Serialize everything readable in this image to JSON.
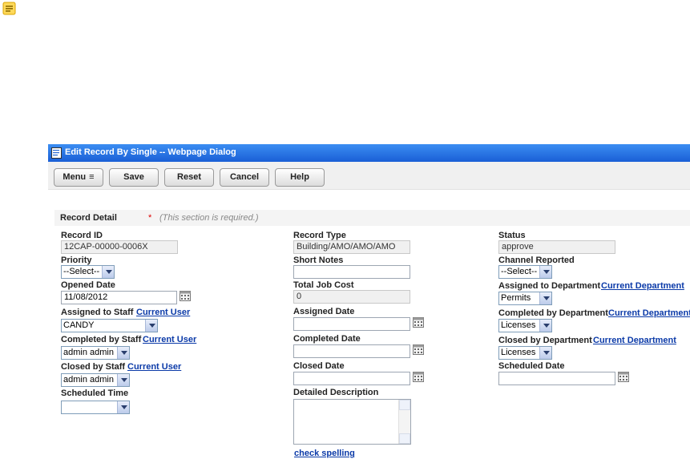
{
  "window": {
    "title": "Edit Record By Single -- Webpage Dialog"
  },
  "toolbar": {
    "menu_label": "Menu",
    "menu_glyph": "≡",
    "save_label": "Save",
    "reset_label": "Reset",
    "cancel_label": "Cancel",
    "help_label": "Help"
  },
  "section": {
    "title": "Record Detail",
    "required_mark": "*",
    "required_note": "(This section is required.)"
  },
  "fields": {
    "record_id": {
      "label": "Record ID",
      "value": "12CAP-00000-0006X"
    },
    "priority": {
      "label": "Priority",
      "value": "--Select--"
    },
    "opened_date": {
      "label": "Opened Date",
      "value": "11/08/2012"
    },
    "assigned_to_staff": {
      "label": "Assigned to Staff",
      "link": "Current User",
      "value": "CANDY"
    },
    "completed_by_staff": {
      "label": "Completed by Staff",
      "link": "Current User",
      "value": "admin admin"
    },
    "closed_by_staff": {
      "label": "Closed by Staff",
      "link": "Current User",
      "value": "admin admin"
    },
    "scheduled_time": {
      "label": "Scheduled Time",
      "value": ""
    },
    "record_type": {
      "label": "Record Type",
      "value": "Building/AMO/AMO/AMO"
    },
    "short_notes": {
      "label": "Short Notes",
      "value": ""
    },
    "total_job_cost": {
      "label": "Total Job Cost",
      "value": "0"
    },
    "assigned_date": {
      "label": "Assigned Date",
      "value": ""
    },
    "completed_date": {
      "label": "Completed Date",
      "value": ""
    },
    "closed_date": {
      "label": "Closed Date",
      "value": ""
    },
    "detailed_description": {
      "label": "Detailed Description",
      "value": "",
      "spell_link": "check spelling"
    },
    "status": {
      "label": "Status",
      "value": "approve"
    },
    "channel_reported": {
      "label": "Channel Reported",
      "value": "--Select--"
    },
    "assigned_to_department": {
      "label": "Assigned to Department",
      "link": "Current Department",
      "value": "Permits"
    },
    "completed_by_department": {
      "label": "Completed by Department",
      "link": "Current Department",
      "value": "Licenses"
    },
    "closed_by_department": {
      "label": "Closed by Department",
      "link": "Current Department",
      "value": "Licenses"
    },
    "scheduled_date": {
      "label": "Scheduled Date",
      "value": ""
    }
  },
  "colors": {
    "title_bar": "#1a5fd6",
    "link": "#0b3aa8",
    "required": "#dd0000"
  }
}
